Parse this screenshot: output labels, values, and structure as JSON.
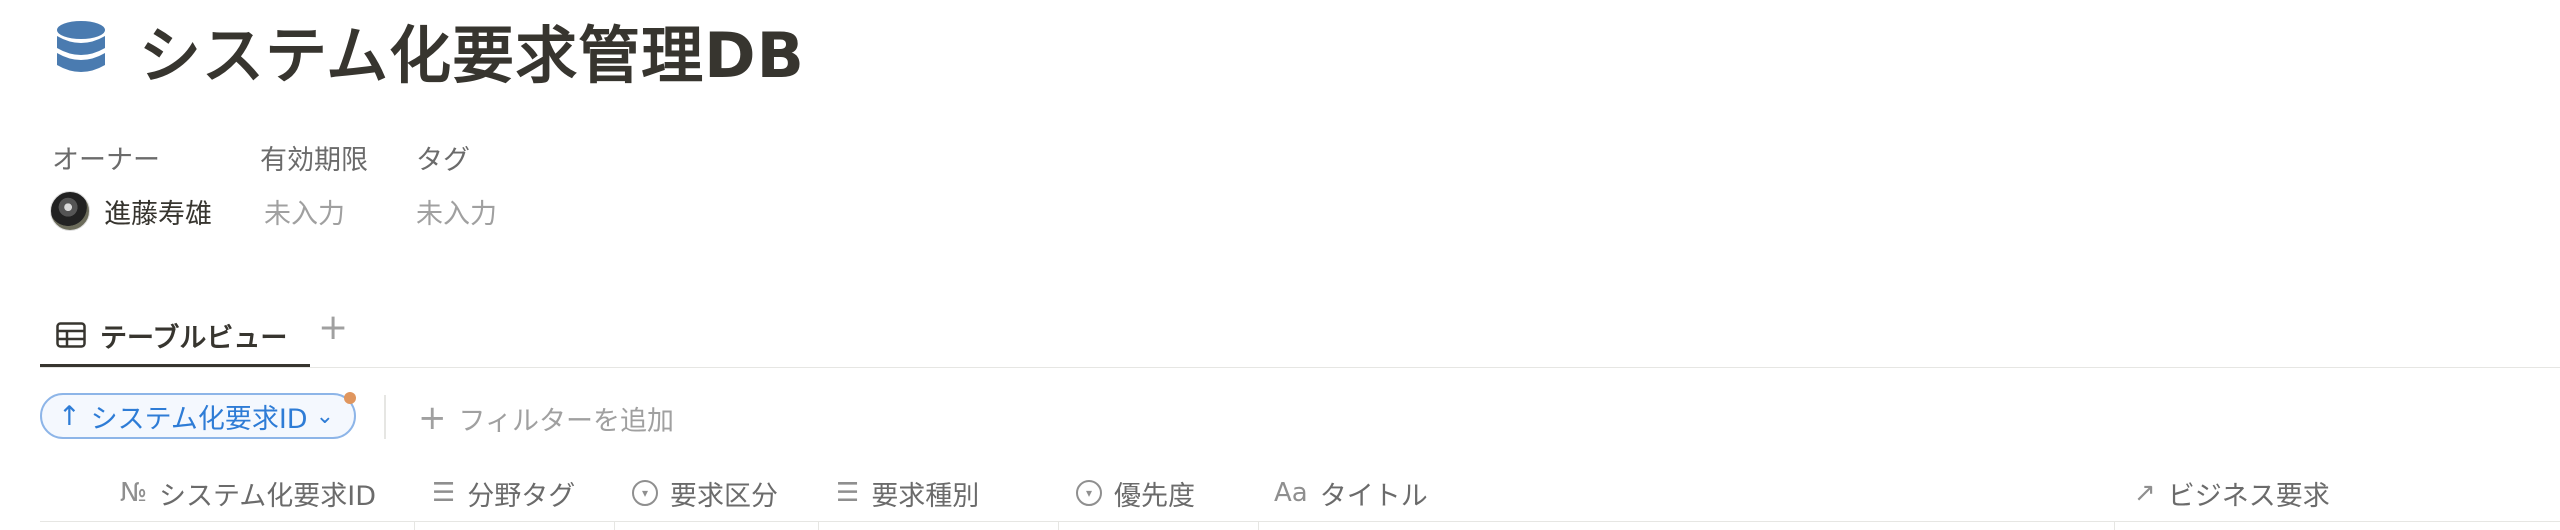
{
  "page": {
    "title": "システム化要求管理DB",
    "icon": "database-icon",
    "accent": "#4a7bb0"
  },
  "properties": {
    "owner_label": "オーナー",
    "owner_value": "進藤寿雄",
    "expiry_label": "有効期限",
    "expiry_value": "未入力",
    "tag_label": "タグ",
    "tag_value": "未入力"
  },
  "tabs": {
    "active_label": "テーブルビュー",
    "add_icon": "plus-icon"
  },
  "toolbar": {
    "sort_arrow": "↑",
    "sort_label": "システム化要求ID",
    "sort_chevron": "⌄",
    "filter_plus": "+",
    "filter_label": "フィルターを追加",
    "sort_color": "#2e7cd6",
    "dot_color": "#e0965e"
  },
  "table": {
    "columns": [
      {
        "icon": "№",
        "label": "システム化要求ID"
      },
      {
        "icon": "☰",
        "label": "分野タグ"
      },
      {
        "icon": "▾",
        "label": "要求区分"
      },
      {
        "icon": "☰",
        "label": "要求種別"
      },
      {
        "icon": "▾",
        "label": "優先度"
      },
      {
        "icon": "Aa",
        "label": "タイトル"
      },
      {
        "icon": "↗",
        "label": "ビジネス要求"
      }
    ]
  }
}
